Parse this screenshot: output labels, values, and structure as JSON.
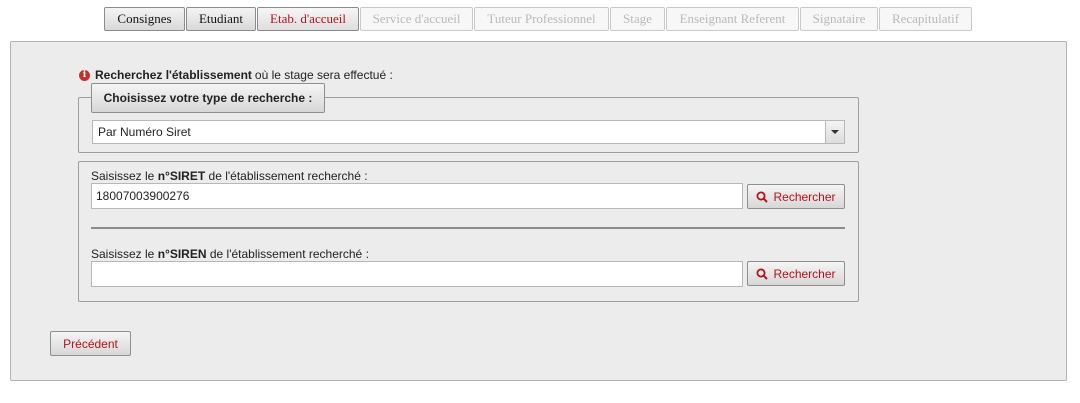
{
  "tabs": [
    {
      "label": "Consignes",
      "state": "done"
    },
    {
      "label": "Etudiant",
      "state": "done"
    },
    {
      "label": "Etab. d'accueil",
      "state": "active"
    },
    {
      "label": "Service d'accueil",
      "state": "disabled"
    },
    {
      "label": "Tuteur Professionnel",
      "state": "disabled"
    },
    {
      "label": "Stage",
      "state": "disabled"
    },
    {
      "label": "Enseignant Referent",
      "state": "disabled"
    },
    {
      "label": "Signataire",
      "state": "disabled"
    },
    {
      "label": "Recapitulatif",
      "state": "disabled"
    }
  ],
  "intro": {
    "icon": "info-icon",
    "bold": "Recherchez l'établissement",
    "rest": "où le stage sera effectué :"
  },
  "search_type": {
    "legend": "Choisissez votre type de recherche :",
    "selected": "Par Numéro Siret"
  },
  "siret": {
    "label_prefix": "Saisissez le",
    "label_bold": "n°SIRET",
    "label_suffix": "de l'établissement recherché :",
    "value": "18007003900276",
    "button": "Rechercher"
  },
  "siren": {
    "label_prefix": "Saisissez le",
    "label_bold": "n°SIREN",
    "label_suffix": "de l'établissement recherché :",
    "value": "",
    "button": "Rechercher"
  },
  "nav": {
    "previous": "Précédent"
  },
  "colors": {
    "accent_red": "#b5121b",
    "panel_bg": "#ececec",
    "disabled_text": "#b9b9b9"
  }
}
